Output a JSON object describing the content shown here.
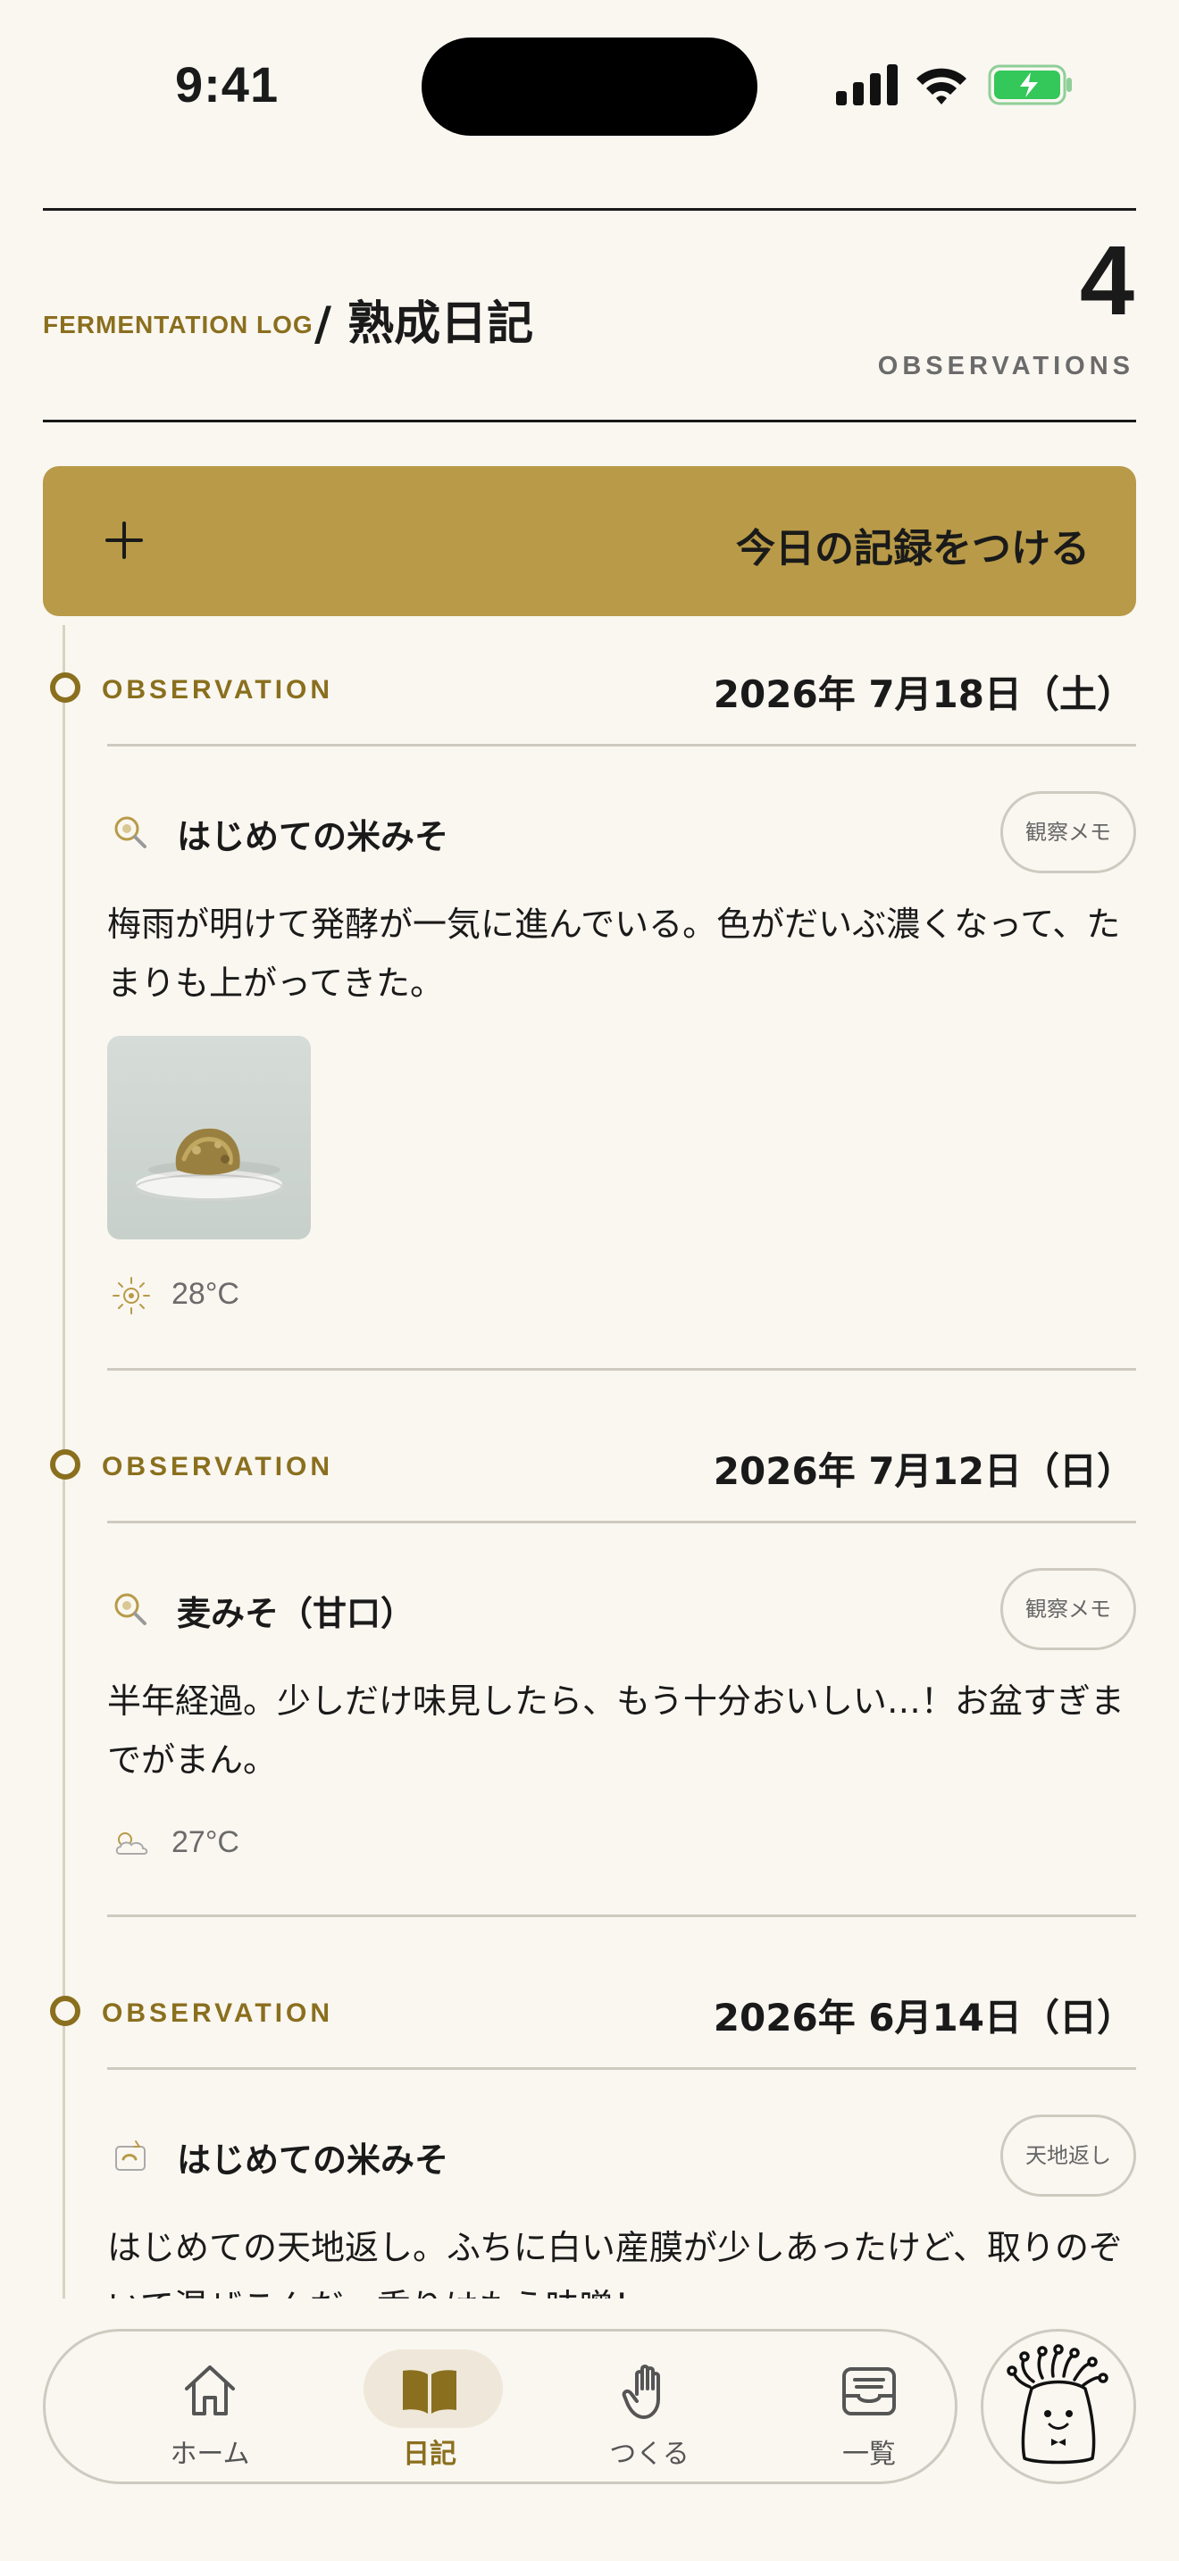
{
  "status_bar": {
    "time": "9:41"
  },
  "header": {
    "eyebrow": "FERMENTATION LOG",
    "title": "/ 熟成日記",
    "count": "4",
    "count_label": "OBSERVATIONS"
  },
  "add_button": {
    "label": "今日の記録をつける",
    "icon": "plus-icon"
  },
  "entries": [
    {
      "label": "OBSERVATION",
      "date": "2026年 7月18日（土）",
      "icon": "magnifier-icon",
      "name": "はじめての米みそ",
      "tag": "観察メモ",
      "text": "梅雨が明けて発酵が一気に進んでいる。色がだいぶ濃くなって、たまりも上がってきた。",
      "has_photo": true,
      "weather_icon": "sun-icon",
      "temp": "28°C"
    },
    {
      "label": "OBSERVATION",
      "date": "2026年 7月12日（日）",
      "icon": "magnifier-icon",
      "name": "麦みそ（甘口）",
      "tag": "観察メモ",
      "text": "半年経過。少しだけ味見したら、もう十分おいしい…！お盆すぎまでがまん。",
      "has_photo": false,
      "weather_icon": "cloudy-icon",
      "temp": "27°C"
    },
    {
      "label": "OBSERVATION",
      "date": "2026年 6月14日（日）",
      "icon": "flip-icon",
      "name": "はじめての米みそ",
      "tag": "天地返し",
      "text": "はじめての天地返し。ふちに白い産膜が少しあったけど、取りのぞいて混ぜこんだ。香りはもう味噌！"
    }
  ],
  "tabs": [
    {
      "label": "ホーム",
      "icon": "home-icon",
      "active": false
    },
    {
      "label": "日記",
      "icon": "book-icon",
      "active": true
    },
    {
      "label": "つくる",
      "icon": "hand-icon",
      "active": false
    },
    {
      "label": "一覧",
      "icon": "tray-icon",
      "active": false
    }
  ],
  "fab": {
    "icon": "mascot-icon"
  },
  "colors": {
    "accent": "#8a6f1e",
    "button": "#b89a48",
    "background": "#faf7f1"
  }
}
